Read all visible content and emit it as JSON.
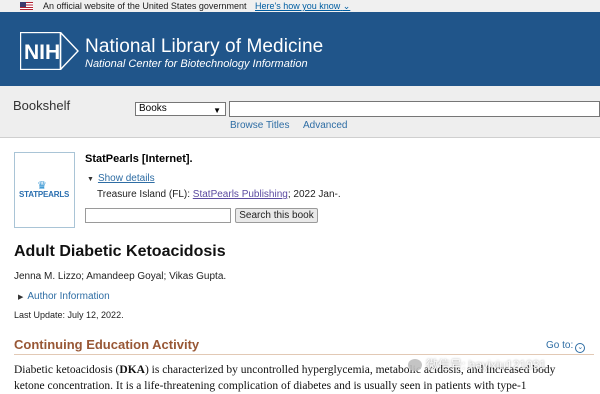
{
  "gov_banner": {
    "text": "An official website of the United States government",
    "link": "Here's how you know"
  },
  "header": {
    "logo_text": "NIH",
    "title": "National Library of Medicine",
    "subtitle": "National Center for Biotechnology Information",
    "color": "#20558a"
  },
  "search": {
    "label": "Bookshelf",
    "database": "Books",
    "query": "",
    "links": [
      "Browse Titles",
      "Advanced"
    ]
  },
  "book": {
    "cover_text": "STATPEARLS",
    "title": "StatPearls [Internet].",
    "show_details": "Show details",
    "publisher_prefix": "Treasure Island (FL): ",
    "publisher_link": "StatPearls Publishing",
    "publisher_suffix": "; 2022 Jan-.",
    "search_value": "",
    "search_button": "Search this book"
  },
  "article": {
    "title": "Adult Diabetic Ketoacidosis",
    "authors": "Jenna M. Lizzo; Amandeep Goyal; Vikas Gupta.",
    "author_info": "Author Information",
    "last_update": "Last Update: July 12, 2022."
  },
  "section": {
    "title": "Continuing Education Activity",
    "goto": "Go to:",
    "line1_pre": "Diabetic ketoacidosis (",
    "line1_bold": "DKA",
    "line1_post": ") is characterized by uncontrolled hyperglycemia, metabolic acidosis, and increased body",
    "line2": "ketone concentration. It is a life-threatening complication of diabetes and is usually seen in patients with type-1"
  },
  "watermark": {
    "text": "微信号: hayixiu121031"
  }
}
